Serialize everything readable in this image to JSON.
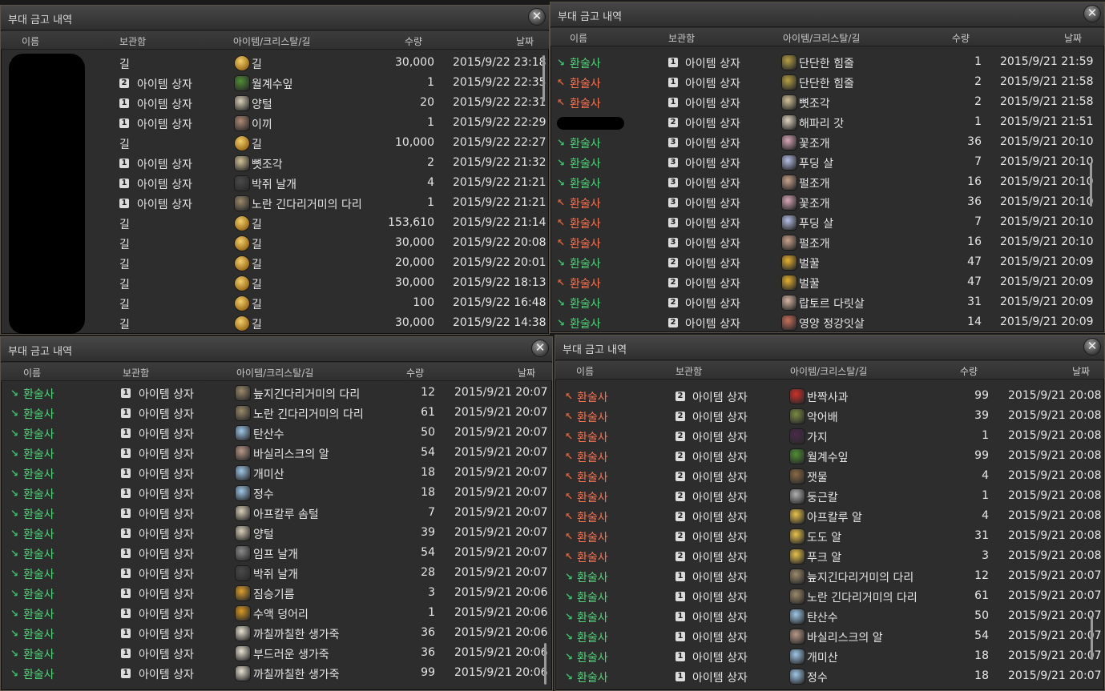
{
  "colors": {
    "incoming": "#4fd67a",
    "outgoing": "#ff7350",
    "panel_bg": "#2d2d2d"
  },
  "columns": {
    "name": "이름",
    "storage": "보관함",
    "item": "아이템/크리스탈/길",
    "qty": "수량",
    "date": "날짜"
  },
  "panels": [
    {
      "title": "부대 금고 내역",
      "rows": [
        {
          "dir": "in",
          "name": "",
          "storage_num": "",
          "storage": "길",
          "icon": "gil",
          "item": "길",
          "qty": "30,000",
          "date": "2015/9/22 23:18"
        },
        {
          "dir": "out",
          "name": "",
          "storage_num": "2",
          "storage": "아이템 상자",
          "icon": "leaf",
          "item": "월계수잎",
          "qty": "1",
          "date": "2015/9/22 22:35"
        },
        {
          "dir": "out",
          "name": "",
          "storage_num": "1",
          "storage": "아이템 상자",
          "icon": "wool",
          "item": "양털",
          "qty": "20",
          "date": "2015/9/22 22:31"
        },
        {
          "dir": "in",
          "name": "",
          "storage_num": "1",
          "storage": "아이템 상자",
          "icon": "moss",
          "item": "이끼",
          "qty": "1",
          "date": "2015/9/22 22:29"
        },
        {
          "dir": "in",
          "name": "",
          "storage_num": "",
          "storage": "길",
          "icon": "gil",
          "item": "길",
          "qty": "10,000",
          "date": "2015/9/22 22:27"
        },
        {
          "dir": "in",
          "name": "",
          "storage_num": "1",
          "storage": "아이템 상자",
          "icon": "bone",
          "item": "뼛조각",
          "qty": "2",
          "date": "2015/9/22 21:32"
        },
        {
          "dir": "in",
          "name": "",
          "storage_num": "1",
          "storage": "아이템 상자",
          "icon": "wing",
          "item": "박쥐 날개",
          "qty": "4",
          "date": "2015/9/22 21:21"
        },
        {
          "dir": "in",
          "name": "",
          "storage_num": "1",
          "storage": "아이템 상자",
          "icon": "leg",
          "item": "노란 긴다리거미의 다리",
          "qty": "1",
          "date": "2015/9/22 21:21"
        },
        {
          "dir": "in",
          "name": "",
          "storage_num": "",
          "storage": "길",
          "icon": "gil",
          "item": "길",
          "qty": "153,610",
          "date": "2015/9/22 21:14"
        },
        {
          "dir": "in",
          "name": "",
          "storage_num": "",
          "storage": "길",
          "icon": "gil",
          "item": "길",
          "qty": "30,000",
          "date": "2015/9/22 20:08"
        },
        {
          "dir": "in",
          "name": "",
          "storage_num": "",
          "storage": "길",
          "icon": "gil",
          "item": "길",
          "qty": "20,000",
          "date": "2015/9/22 20:01"
        },
        {
          "dir": "in",
          "name": "",
          "storage_num": "",
          "storage": "길",
          "icon": "gil",
          "item": "길",
          "qty": "30,000",
          "date": "2015/9/22 18:13"
        },
        {
          "dir": "in",
          "name": "",
          "storage_num": "",
          "storage": "길",
          "icon": "gil",
          "item": "길",
          "qty": "100",
          "date": "2015/9/22 16:48"
        },
        {
          "dir": "in",
          "name": "",
          "storage_num": "",
          "storage": "길",
          "icon": "gil",
          "item": "길",
          "qty": "30,000",
          "date": "2015/9/22 14:38"
        }
      ]
    },
    {
      "title": "부대 금고 내역",
      "rows": [
        {
          "dir": "in",
          "name": "환술사",
          "storage_num": "1",
          "storage": "아이템 상자",
          "icon": "rope",
          "item": "단단한 힘줄",
          "qty": "1",
          "date": "2015/9/21 21:59"
        },
        {
          "dir": "out",
          "name": "환술사",
          "storage_num": "1",
          "storage": "아이템 상자",
          "icon": "rope",
          "item": "단단한 힘줄",
          "qty": "2",
          "date": "2015/9/21 21:58"
        },
        {
          "dir": "out",
          "name": "환술사",
          "storage_num": "1",
          "storage": "아이템 상자",
          "icon": "bone",
          "item": "뼛조각",
          "qty": "2",
          "date": "2015/9/21 21:58"
        },
        {
          "dir": "in",
          "name": "",
          "storage_num": "2",
          "storage": "아이템 상자",
          "icon": "hat",
          "item": "해파리 갓",
          "qty": "1",
          "date": "2015/9/21 21:51"
        },
        {
          "dir": "in",
          "name": "환술사",
          "storage_num": "3",
          "storage": "아이템 상자",
          "icon": "clam",
          "item": "꽃조개",
          "qty": "36",
          "date": "2015/9/21 20:10"
        },
        {
          "dir": "in",
          "name": "환술사",
          "storage_num": "3",
          "storage": "아이템 상자",
          "icon": "pudding",
          "item": "푸딩 살",
          "qty": "7",
          "date": "2015/9/21 20:10"
        },
        {
          "dir": "in",
          "name": "환술사",
          "storage_num": "3",
          "storage": "아이템 상자",
          "icon": "shell",
          "item": "펄조개",
          "qty": "16",
          "date": "2015/9/21 20:10"
        },
        {
          "dir": "out",
          "name": "환술사",
          "storage_num": "3",
          "storage": "아이템 상자",
          "icon": "clam",
          "item": "꽃조개",
          "qty": "36",
          "date": "2015/9/21 20:10"
        },
        {
          "dir": "out",
          "name": "환술사",
          "storage_num": "3",
          "storage": "아이템 상자",
          "icon": "pudding",
          "item": "푸딩 살",
          "qty": "7",
          "date": "2015/9/21 20:10"
        },
        {
          "dir": "out",
          "name": "환술사",
          "storage_num": "3",
          "storage": "아이템 상자",
          "icon": "shell",
          "item": "펄조개",
          "qty": "16",
          "date": "2015/9/21 20:10"
        },
        {
          "dir": "in",
          "name": "환술사",
          "storage_num": "2",
          "storage": "아이템 상자",
          "icon": "honey",
          "item": "벌꿀",
          "qty": "47",
          "date": "2015/9/21 20:09"
        },
        {
          "dir": "out",
          "name": "환술사",
          "storage_num": "2",
          "storage": "아이템 상자",
          "icon": "honey",
          "item": "벌꿀",
          "qty": "47",
          "date": "2015/9/21 20:09"
        },
        {
          "dir": "in",
          "name": "환술사",
          "storage_num": "2",
          "storage": "아이템 상자",
          "icon": "meat",
          "item": "랍토르 다릿살",
          "qty": "31",
          "date": "2015/9/21 20:09"
        },
        {
          "dir": "in",
          "name": "환술사",
          "storage_num": "2",
          "storage": "아이템 상자",
          "icon": "steak",
          "item": "영양 정강잇살",
          "qty": "14",
          "date": "2015/9/21 20:09"
        }
      ]
    },
    {
      "title": "부대 금고 내역",
      "rows": [
        {
          "dir": "in",
          "name": "환술사",
          "storage_num": "1",
          "storage": "아이템 상자",
          "icon": "leg",
          "item": "늪지긴다리거미의 다리",
          "qty": "12",
          "date": "2015/9/21 20:07"
        },
        {
          "dir": "in",
          "name": "환술사",
          "storage_num": "1",
          "storage": "아이템 상자",
          "icon": "leg",
          "item": "노란 긴다리거미의 다리",
          "qty": "61",
          "date": "2015/9/21 20:07"
        },
        {
          "dir": "in",
          "name": "환술사",
          "storage_num": "1",
          "storage": "아이템 상자",
          "icon": "vial",
          "item": "탄산수",
          "qty": "50",
          "date": "2015/9/21 20:07"
        },
        {
          "dir": "in",
          "name": "환술사",
          "storage_num": "1",
          "storage": "아이템 상자",
          "icon": "egg-dark",
          "item": "바실리스크의 알",
          "qty": "54",
          "date": "2015/9/21 20:07"
        },
        {
          "dir": "in",
          "name": "환술사",
          "storage_num": "1",
          "storage": "아이템 상자",
          "icon": "vial",
          "item": "개미산",
          "qty": "18",
          "date": "2015/9/21 20:07"
        },
        {
          "dir": "in",
          "name": "환술사",
          "storage_num": "1",
          "storage": "아이템 상자",
          "icon": "vial",
          "item": "정수",
          "qty": "18",
          "date": "2015/9/21 20:07"
        },
        {
          "dir": "in",
          "name": "환술사",
          "storage_num": "1",
          "storage": "아이템 상자",
          "icon": "wool",
          "item": "아프칼루 솜털",
          "qty": "7",
          "date": "2015/9/21 20:07"
        },
        {
          "dir": "in",
          "name": "환술사",
          "storage_num": "1",
          "storage": "아이템 상자",
          "icon": "wool",
          "item": "양털",
          "qty": "39",
          "date": "2015/9/21 20:07"
        },
        {
          "dir": "in",
          "name": "환술사",
          "storage_num": "1",
          "storage": "아이템 상자",
          "icon": "wing-grey",
          "item": "임프 날개",
          "qty": "54",
          "date": "2015/9/21 20:07"
        },
        {
          "dir": "in",
          "name": "환술사",
          "storage_num": "1",
          "storage": "아이템 상자",
          "icon": "wing",
          "item": "박쥐 날개",
          "qty": "28",
          "date": "2015/9/21 20:07"
        },
        {
          "dir": "in",
          "name": "환술사",
          "storage_num": "1",
          "storage": "아이템 상자",
          "icon": "fat",
          "item": "짐승기름",
          "qty": "3",
          "date": "2015/9/21 20:06"
        },
        {
          "dir": "in",
          "name": "환술사",
          "storage_num": "1",
          "storage": "아이템 상자",
          "icon": "resin",
          "item": "수액 덩어리",
          "qty": "1",
          "date": "2015/9/21 20:06"
        },
        {
          "dir": "in",
          "name": "환술사",
          "storage_num": "1",
          "storage": "아이템 상자",
          "icon": "hide",
          "item": "까칠까칠한 생가죽",
          "qty": "36",
          "date": "2015/9/21 20:06"
        },
        {
          "dir": "in",
          "name": "환술사",
          "storage_num": "1",
          "storage": "아이템 상자",
          "icon": "hide",
          "item": "부드러운 생가죽",
          "qty": "36",
          "date": "2015/9/21 20:06"
        },
        {
          "dir": "in",
          "name": "환술사",
          "storage_num": "1",
          "storage": "아이템 상자",
          "icon": "hide",
          "item": "까칠까칠한 생가죽",
          "qty": "99",
          "date": "2015/9/21 20:06"
        }
      ]
    },
    {
      "title": "부대 금고 내역",
      "rows": [
        {
          "dir": "out",
          "name": "환술사",
          "storage_num": "2",
          "storage": "아이템 상자",
          "icon": "apple",
          "item": "반짝사과",
          "qty": "99",
          "date": "2015/9/21 20:08"
        },
        {
          "dir": "out",
          "name": "환술사",
          "storage_num": "2",
          "storage": "아이템 상자",
          "icon": "pear",
          "item": "악어배",
          "qty": "39",
          "date": "2015/9/21 20:08"
        },
        {
          "dir": "out",
          "name": "환술사",
          "storage_num": "2",
          "storage": "아이템 상자",
          "icon": "eggplant",
          "item": "가지",
          "qty": "1",
          "date": "2015/9/21 20:08"
        },
        {
          "dir": "out",
          "name": "환술사",
          "storage_num": "2",
          "storage": "아이템 상자",
          "icon": "leaf",
          "item": "월계수잎",
          "qty": "99",
          "date": "2015/9/21 20:08"
        },
        {
          "dir": "out",
          "name": "환술사",
          "storage_num": "2",
          "storage": "아이템 상자",
          "icon": "bottle",
          "item": "잿물",
          "qty": "4",
          "date": "2015/9/21 20:08"
        },
        {
          "dir": "out",
          "name": "환술사",
          "storage_num": "2",
          "storage": "아이템 상자",
          "icon": "knife",
          "item": "둥근칼",
          "qty": "1",
          "date": "2015/9/21 20:08"
        },
        {
          "dir": "out",
          "name": "환술사",
          "storage_num": "2",
          "storage": "아이템 상자",
          "icon": "egg",
          "item": "아프칼루 알",
          "qty": "4",
          "date": "2015/9/21 20:08"
        },
        {
          "dir": "out",
          "name": "환술사",
          "storage_num": "2",
          "storage": "아이템 상자",
          "icon": "egg",
          "item": "도도 알",
          "qty": "31",
          "date": "2015/9/21 20:08"
        },
        {
          "dir": "out",
          "name": "환술사",
          "storage_num": "2",
          "storage": "아이템 상자",
          "icon": "egg",
          "item": "푸크 알",
          "qty": "3",
          "date": "2015/9/21 20:08"
        },
        {
          "dir": "in",
          "name": "환술사",
          "storage_num": "1",
          "storage": "아이템 상자",
          "icon": "leg",
          "item": "늪지긴다리거미의 다리",
          "qty": "12",
          "date": "2015/9/21 20:07"
        },
        {
          "dir": "in",
          "name": "환술사",
          "storage_num": "1",
          "storage": "아이템 상자",
          "icon": "leg",
          "item": "노란 긴다리거미의 다리",
          "qty": "61",
          "date": "2015/9/21 20:07"
        },
        {
          "dir": "in",
          "name": "환술사",
          "storage_num": "1",
          "storage": "아이템 상자",
          "icon": "vial",
          "item": "탄산수",
          "qty": "50",
          "date": "2015/9/21 20:07"
        },
        {
          "dir": "in",
          "name": "환술사",
          "storage_num": "1",
          "storage": "아이템 상자",
          "icon": "egg-dark",
          "item": "바실리스크의 알",
          "qty": "54",
          "date": "2015/9/21 20:07"
        },
        {
          "dir": "in",
          "name": "환술사",
          "storage_num": "1",
          "storage": "아이템 상자",
          "icon": "vial",
          "item": "개미산",
          "qty": "18",
          "date": "2015/9/21 20:07"
        },
        {
          "dir": "in",
          "name": "환술사",
          "storage_num": "1",
          "storage": "아이템 상자",
          "icon": "vial",
          "item": "정수",
          "qty": "18",
          "date": "2015/9/21 20:07"
        }
      ]
    }
  ]
}
